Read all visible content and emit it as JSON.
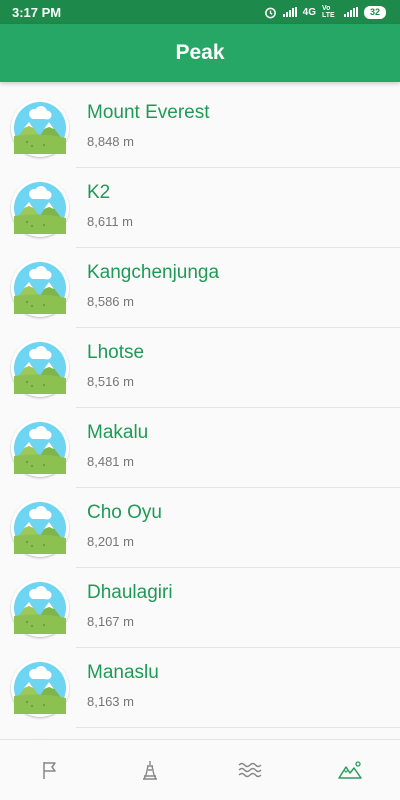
{
  "status": {
    "time": "3:17 PM",
    "network": "4G",
    "lte": "Vo LTE",
    "battery": "32"
  },
  "title": "Peak",
  "peaks": [
    {
      "name": "Mount Everest",
      "height": "8,848 m"
    },
    {
      "name": "K2",
      "height": "8,611 m"
    },
    {
      "name": "Kangchenjunga",
      "height": "8,586 m"
    },
    {
      "name": "Lhotse",
      "height": "8,516 m"
    },
    {
      "name": "Makalu",
      "height": "8,481 m"
    },
    {
      "name": "Cho Oyu",
      "height": "8,201 m"
    },
    {
      "name": "Dhaulagiri",
      "height": "8,167 m"
    },
    {
      "name": "Manaslu",
      "height": "8,163 m"
    }
  ],
  "colors": {
    "primary": "#26a765",
    "statusbar": "#1d8a4b",
    "accent_text": "#1f9a55",
    "nav_active": "#2a9d5c",
    "nav_inactive": "#888888"
  },
  "bottom_nav": [
    {
      "icon": "flag-icon",
      "active": false
    },
    {
      "icon": "tower-icon",
      "active": false
    },
    {
      "icon": "waves-icon",
      "active": false
    },
    {
      "icon": "mountain-icon",
      "active": true
    }
  ]
}
